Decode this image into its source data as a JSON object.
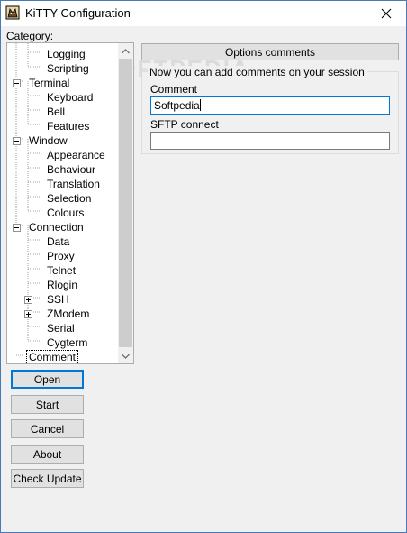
{
  "window": {
    "title": "KiTTY Configuration",
    "icons": {
      "app": "kitty-cat-icon",
      "close": "close-icon"
    }
  },
  "category_label": "Category:",
  "tree": {
    "items": [
      {
        "label": "Logging",
        "level": 2,
        "expander": "none"
      },
      {
        "label": "Scripting",
        "level": 2,
        "expander": "none"
      },
      {
        "label": "Terminal",
        "level": 1,
        "expander": "minus"
      },
      {
        "label": "Keyboard",
        "level": 2,
        "expander": "none"
      },
      {
        "label": "Bell",
        "level": 2,
        "expander": "none"
      },
      {
        "label": "Features",
        "level": 2,
        "expander": "none"
      },
      {
        "label": "Window",
        "level": 1,
        "expander": "minus"
      },
      {
        "label": "Appearance",
        "level": 2,
        "expander": "none"
      },
      {
        "label": "Behaviour",
        "level": 2,
        "expander": "none"
      },
      {
        "label": "Translation",
        "level": 2,
        "expander": "none"
      },
      {
        "label": "Selection",
        "level": 2,
        "expander": "none"
      },
      {
        "label": "Colours",
        "level": 2,
        "expander": "none"
      },
      {
        "label": "Connection",
        "level": 1,
        "expander": "minus"
      },
      {
        "label": "Data",
        "level": 2,
        "expander": "none"
      },
      {
        "label": "Proxy",
        "level": 2,
        "expander": "none"
      },
      {
        "label": "Telnet",
        "level": 2,
        "expander": "none"
      },
      {
        "label": "Rlogin",
        "level": 2,
        "expander": "none"
      },
      {
        "label": "SSH",
        "level": 2,
        "expander": "plus"
      },
      {
        "label": "ZModem",
        "level": 2,
        "expander": "plus"
      },
      {
        "label": "Serial",
        "level": 2,
        "expander": "none"
      },
      {
        "label": "Cygterm",
        "level": 2,
        "expander": "none"
      },
      {
        "label": "Comment",
        "level": 1,
        "expander": "none",
        "selected": true
      }
    ],
    "scroll_icons": {
      "up": "scroll-up-arrow-icon",
      "down": "scroll-down-arrow-icon"
    }
  },
  "buttons": {
    "open": "Open",
    "start": "Start",
    "cancel": "Cancel",
    "about": "About",
    "check_update": "Check Update"
  },
  "panel": {
    "header": "Options comments",
    "group_title": "Now you can add comments on your session",
    "comment_label": "Comment",
    "comment_value": "Softpedia",
    "sftp_label": "SFTP connect",
    "sftp_value": ""
  },
  "watermark": "SOFTPEDIA",
  "colors": {
    "accent": "#0078d7",
    "border": "#adadad",
    "button_face": "#e1e1e1"
  }
}
